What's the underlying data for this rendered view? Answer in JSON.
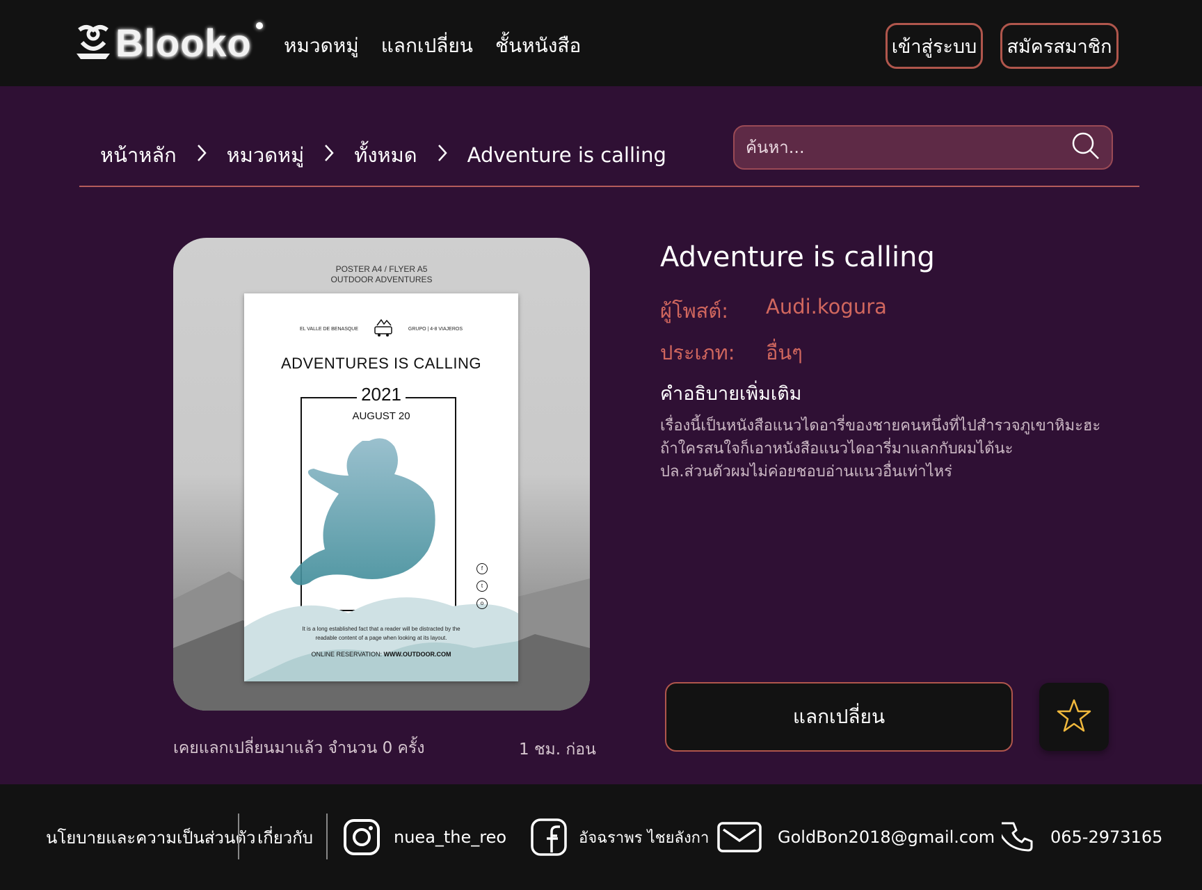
{
  "header": {
    "logo_text": "Blooko",
    "nav": [
      "หมวดหมู่",
      "แลกเปลี่ยน",
      "ชั้นหนังสือ"
    ],
    "login_label": "เข้าสู่ระบบ",
    "signup_label": "สมัครสมาชิก"
  },
  "breadcrumb": [
    "หน้าหลัก",
    "หมวดหมู่",
    "ทั้งหมด",
    "Adventure is calling"
  ],
  "search": {
    "placeholder": "ค้นหา..."
  },
  "book": {
    "title": "Adventure is calling",
    "poster_label": "ผู้โพสต์:",
    "poster_value": "Audi.kogura",
    "type_label": "ประเภท:",
    "type_value": "อื่นๆ",
    "desc_label": "คำอธิบายเพิ่มเติม",
    "description": [
      "เรื่องนี้เป็นหนังสือแนวไดอารี่ของชายคนหนึ่งที่ไปสำรวจภูเขาหิมะฮะ",
      "ถ้าใครสนใจก็เอาหนังสือแนวไดอารี่มาแลกกับผมได้นะ",
      "ปล.ส่วนตัวผมไม่ค่อยชอบอ่านแนวอื่นเท่าไหร่"
    ],
    "exchange_count_text": "เคยแลกเปลี่ยนมาแล้ว จำนวน 0 ครั้ง",
    "posted_time": "1 ชม. ก่อน",
    "exchange_button": "แลกเปลี่ยน",
    "cover": {
      "head_line1": "POSTER A4 / FLYER A5",
      "head_line2": "OUTDOOR ADVENTURES",
      "top_left": "EL VALLE DE BENASQUE",
      "top_right": "GRUPO | 4-8 VIAJEROS",
      "title": "ADVENTURES IS CALLING",
      "year": "2021",
      "date": "AUGUST 20",
      "body": "It is a long established fact that a reader will be distracted by the readable content of a page when looking at its layout.",
      "reservation_label": "ONLINE RESERVATION:",
      "reservation_url": "WWW.OUTDOOR.COM"
    }
  },
  "footer": {
    "privacy": "นโยบายและความเป็นส่วนตัว",
    "about": "เกี่ยวกับ",
    "instagram": "nuea_the_reo",
    "facebook": "อัจฉราพร ไชยลังกา",
    "email": "GoldBon2018@gmail.com",
    "phone": "065-2973165"
  },
  "colors": {
    "background": "#2f1034",
    "header": "#121212",
    "accent": "#d1675e",
    "border_accent": "#b0564c",
    "star": "#f0b83c"
  },
  "icons": [
    "search-icon",
    "chevron-right-icon",
    "star-icon",
    "instagram-icon",
    "facebook-icon",
    "mail-icon",
    "phone-icon"
  ]
}
